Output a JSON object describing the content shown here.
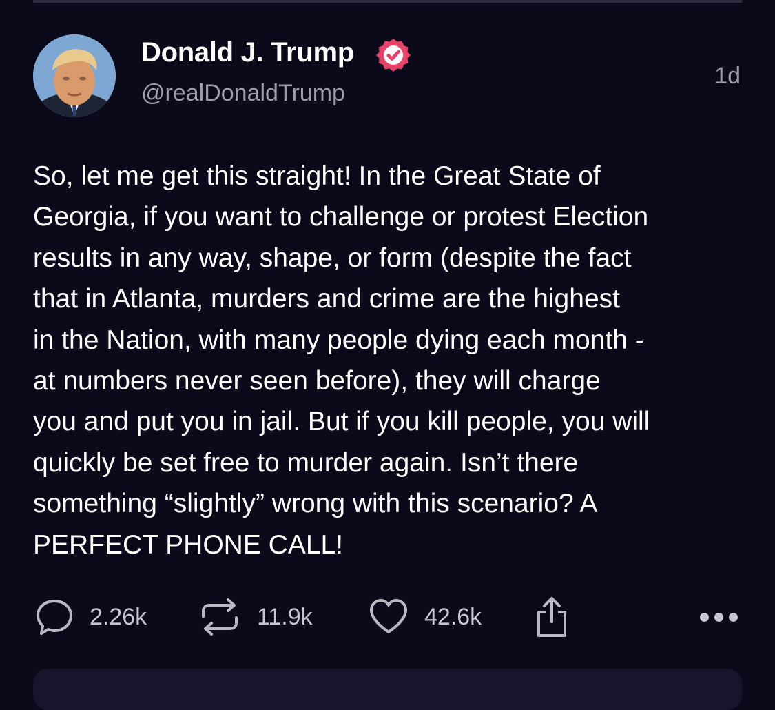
{
  "post": {
    "display_name": "Donald J. Trump",
    "handle": "@realDonaldTrump",
    "timestamp": "1d",
    "verified_badge_color": "#e5436a",
    "lines": [
      "So, let me get this straight! In the Great State of",
      "Georgia, if you want to challenge or protest Election",
      "results in any way, shape, or form (despite the fact",
      "that in Atlanta, murders and crime are the highest",
      "in the Nation, with many people dying each month -",
      "at numbers never seen before), they will charge",
      "you and put you in jail. But if you kill people, you will",
      "quickly be set free to murder again. Isn’t there",
      "something “slightly” wrong with this scenario? A",
      "PERFECT PHONE CALL!"
    ]
  },
  "actions": {
    "replies": {
      "icon": "reply-icon",
      "count": "2.26k"
    },
    "reposts": {
      "icon": "repost-icon",
      "count": "11.9k"
    },
    "likes": {
      "icon": "heart-icon",
      "count": "42.6k"
    },
    "share": {
      "icon": "share-icon"
    },
    "more": {
      "icon": "more-icon"
    }
  },
  "colors": {
    "background": "#0b0a1a",
    "secondary_text": "#9c9cab"
  }
}
